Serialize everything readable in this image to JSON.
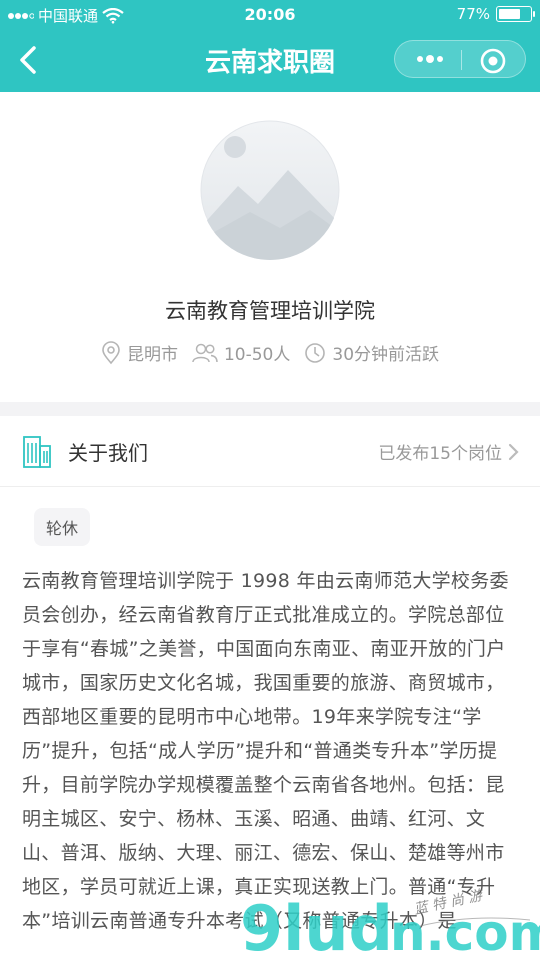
{
  "status_bar": {
    "carrier": "中国联通",
    "time": "20:06",
    "battery": "77%",
    "battery_level": 0.77
  },
  "navbar": {
    "title": "云南求职圈"
  },
  "profile": {
    "company_name": "云南教育管理培训学院",
    "location": "昆明市",
    "size": "10-50人",
    "activity": "30分钟前活跃"
  },
  "about": {
    "title": "关于我们",
    "posted_jobs": "已发布15个岗位",
    "tag": "轮休",
    "description": "云南教育管理培训学院于 1998 年由云南师范大学校务委员会创办，经云南省教育厅正式批准成立的。学院总部位于享有“春城”之美誉，中国面向东南亚、南亚开放的门户城市，国家历史文化名城，我国重要的旅游、商贸城市，西部地区重要的昆明市中心地带。19年来学院专注“学历”提升，包括“成人学历”提升和“普通类专升本”学历提升，目前学院办学规模覆盖整个云南省各地州。包括：昆明主城区、安宁、杨林、玉溪、昭通、曲靖、红河、文山、普洱、版纳、大理、丽江、德宏、保山、楚雄等州市地区，学员可就近上课，真正实现送教上门。普通“专升本”培训云南普通专升本考试（又称普通专升本）是"
  },
  "watermark": {
    "text": "9ludn.com",
    "script": "蓝 特 尚 游"
  },
  "colors": {
    "brand": "#2fc5c2",
    "text_primary": "#333333",
    "text_secondary": "#999999"
  }
}
